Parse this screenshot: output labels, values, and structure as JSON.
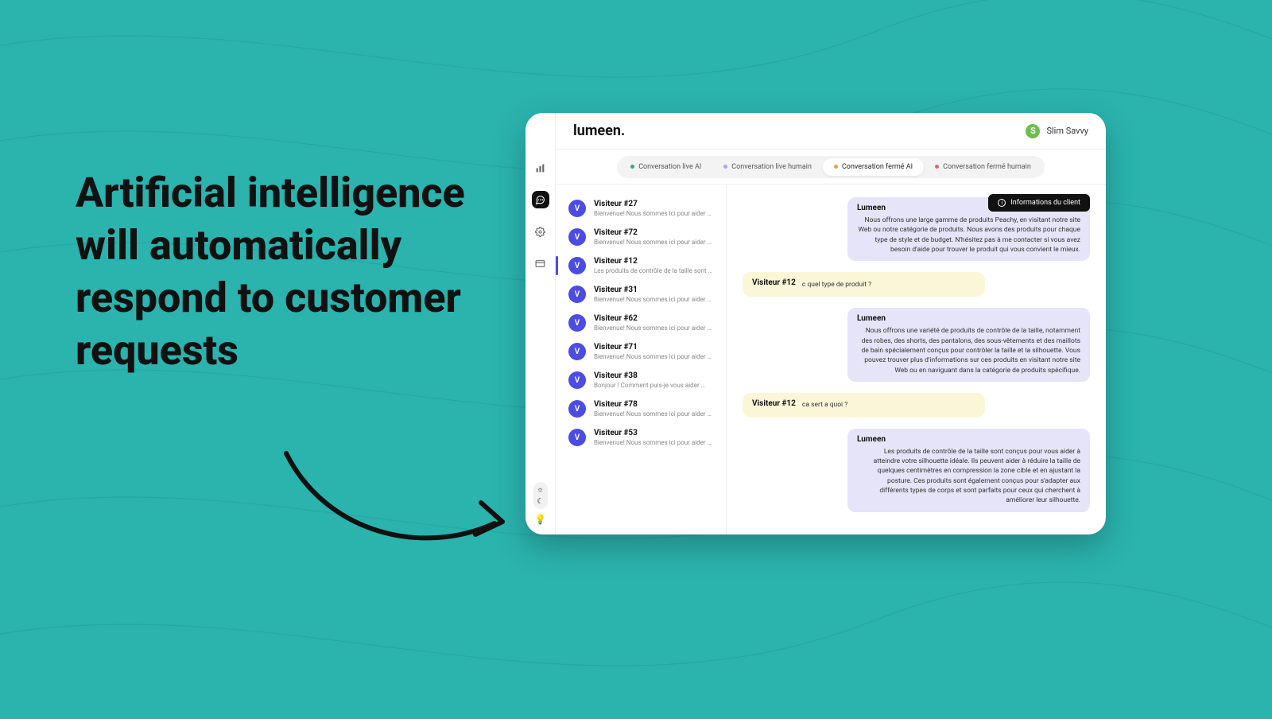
{
  "headline": "Artificial intelligence will automatically respond to customer requests",
  "app": {
    "brand": "lumeen.",
    "user_name": "Slim Savvy",
    "user_initial": "S",
    "info_button": "Informations du client"
  },
  "tabs": [
    {
      "label": "Conversation live AI",
      "dot": "#2BB36A",
      "active": false
    },
    {
      "label": "Conversation live humain",
      "dot": "#A8A8F0",
      "active": false
    },
    {
      "label": "Conversation fermé AI",
      "dot": "#E9A23B",
      "active": true
    },
    {
      "label": "Conversation fermé humain",
      "dot": "#D46B6B",
      "active": false
    }
  ],
  "conversations": [
    {
      "title": "Visiteur #27",
      "preview": "Bienvenue! Nous sommes ici pour aider …",
      "selected": false
    },
    {
      "title": "Visiteur #72",
      "preview": "Bienvenue! Nous sommes ici pour aider …",
      "selected": false
    },
    {
      "title": "Visiteur #12",
      "preview": "Les produits de contrôle de la taille sont …",
      "selected": true
    },
    {
      "title": "Visiteur #31",
      "preview": "Bienvenue! Nous sommes ici pour aider …",
      "selected": false
    },
    {
      "title": "Visiteur #62",
      "preview": "Bienvenue! Nous sommes ici pour aider …",
      "selected": false
    },
    {
      "title": "Visiteur #71",
      "preview": "Bienvenue! Nous sommes ici pour aider …",
      "selected": false
    },
    {
      "title": "Visiteur #38",
      "preview": "Bonjour ! Comment puis-je vous aider …",
      "selected": false
    },
    {
      "title": "Visiteur #78",
      "preview": "Bienvenue! Nous sommes ici pour aider …",
      "selected": false
    },
    {
      "title": "Visiteur #53",
      "preview": "Bienvenue! Nous sommes ici pour aider …",
      "selected": false
    }
  ],
  "messages": [
    {
      "role": "bot",
      "sender": "Lumeen",
      "body": "Nous offrons une large gamme de produits Peachy, en visitant notre site Web ou notre catégorie de produits. Nous avons des produits pour chaque type de style et de budget. N'hésitez pas à me contacter si vous avez besoin d'aide pour trouver le produit qui vous convient le mieux."
    },
    {
      "role": "user",
      "sender": "Visiteur #12",
      "body": "c quel type de produit ?"
    },
    {
      "role": "bot",
      "sender": "Lumeen",
      "body": "Nous offrons une variété de produits de contrôle de la taille, notamment des robes, des shorts, des pantalons, des sous-vêtements et des maillots de bain spécialement conçus pour contrôler la taille et la silhouette. Vous pouvez trouver plus d'informations sur ces produits en visitant notre site Web ou en naviguant dans la catégorie de produits spécifique."
    },
    {
      "role": "user",
      "sender": "Visiteur #12",
      "body": "ca sert a quoi ?"
    },
    {
      "role": "bot",
      "sender": "Lumeen",
      "body": "Les produits de contrôle de la taille sont conçus pour vous aider à atteindre votre silhouette idéale. Ils peuvent aider à réduire la taille de quelques centimètres en compression la zone cible et en ajustant la posture. Ces produits sont également conçus pour s'adapter aux différents types de corps et sont parfaits pour ceux qui cherchent à améliorer leur silhouette."
    }
  ],
  "rail_icons": {
    "analytics": "analytics-icon",
    "chat": "chat-icon",
    "settings": "gear-icon",
    "billing": "card-icon"
  }
}
